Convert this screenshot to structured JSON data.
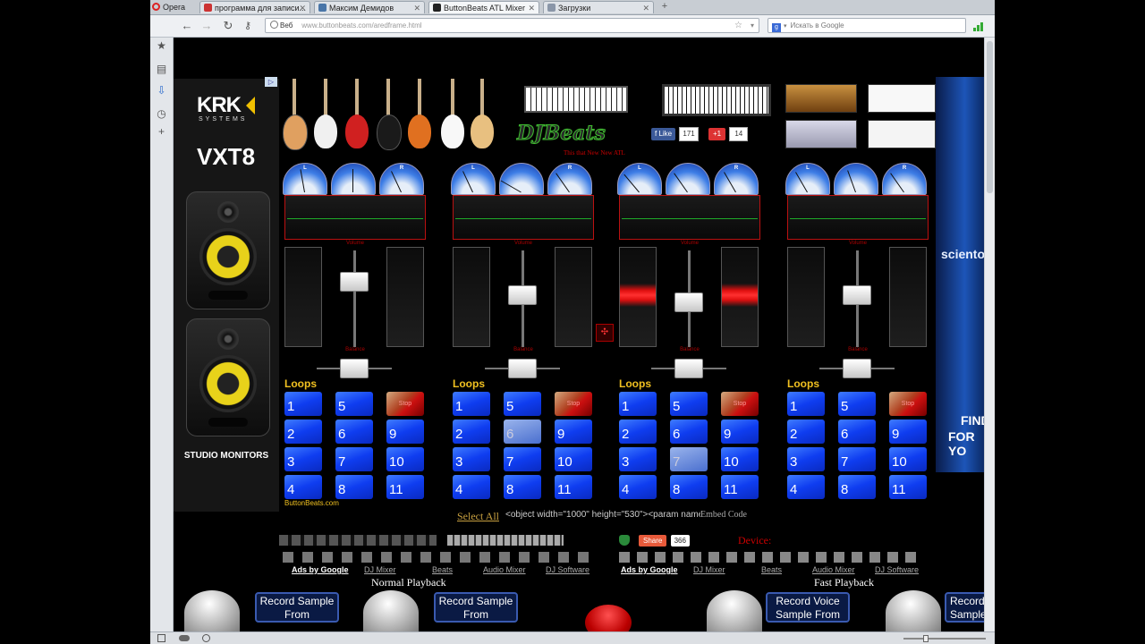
{
  "browser": {
    "opera_label": "Opera",
    "tabs": [
      {
        "label": "программа для записи...",
        "icon_color": "#cc3333"
      },
      {
        "label": "Максим Демидов",
        "icon_color": "#4a76a8"
      },
      {
        "label": "ButtonBeats ATL Mixer",
        "icon_color": "#222222"
      },
      {
        "label": "Загрузки",
        "icon_color": "#8a96a8"
      }
    ],
    "web_badge": "Веб",
    "url": "www.buttonbeats.com/aredframe.html",
    "search_placeholder": "Искать в Google"
  },
  "page": {
    "krk": {
      "brand": "KRK",
      "sub": "SYSTEMS",
      "model": "VXT8",
      "footer": "STUDIO MONITORS"
    },
    "ad_right": {
      "mid": "sciento",
      "find": "FIND",
      "for": "FOR YO"
    },
    "logo": "DJBeats",
    "like": {
      "label": "Like",
      "count": "171"
    },
    "gplus": {
      "label": "+1",
      "count": "14"
    },
    "tagline": "This that New New ATL",
    "vu_labels": [
      "L",
      "",
      "R"
    ],
    "volume_label": "Volume",
    "balance_label": "Balance",
    "loops_label": "Loops",
    "stop_label": "Stop",
    "site_credit": "ButtonBeats.com",
    "select_all": "Select All",
    "embed_code": "<object width=\"1000\" height=\"530\"><param name",
    "embed_label": "Embed Code",
    "share": {
      "label": "Share",
      "count": "366"
    },
    "device_label": "Device:",
    "footer_left": {
      "ads": "Ads by Google",
      "links": [
        "DJ Mixer",
        "Beats",
        "Audio Mixer",
        "DJ Software"
      ],
      "playback": "Normal Playback"
    },
    "footer_right": {
      "ads": "Ads by Google",
      "links": [
        "DJ Mixer",
        "Beats",
        "Audio Mixer",
        "DJ Software"
      ],
      "playback": "Fast Playback"
    },
    "record_buttons": [
      "Record Sample From",
      "Record Sample From",
      "Record Voice Sample From",
      "Record Sample"
    ]
  },
  "decks": [
    {
      "loops": [
        "1",
        "5",
        "Stop",
        "2",
        "6",
        "9",
        "3",
        "7",
        "10",
        "4",
        "8",
        "11"
      ],
      "active_index": -1,
      "hot": false,
      "fader": 0.28,
      "balance": 0.5
    },
    {
      "loops": [
        "1",
        "5",
        "Stop",
        "2",
        "6",
        "9",
        "3",
        "7",
        "10",
        "4",
        "8",
        "11"
      ],
      "active_index": 4,
      "hot": false,
      "fader": 0.45,
      "balance": 0.5
    },
    {
      "loops": [
        "1",
        "5",
        "Stop",
        "2",
        "6",
        "9",
        "3",
        "7",
        "10",
        "4",
        "8",
        "11"
      ],
      "active_index": 7,
      "hot": true,
      "fader": 0.55,
      "balance": 0.5
    },
    {
      "loops": [
        "1",
        "5",
        "Stop",
        "2",
        "6",
        "9",
        "3",
        "7",
        "10",
        "4",
        "8",
        "11"
      ],
      "active_index": -1,
      "hot": false,
      "fader": 0.45,
      "balance": 0.5
    }
  ]
}
